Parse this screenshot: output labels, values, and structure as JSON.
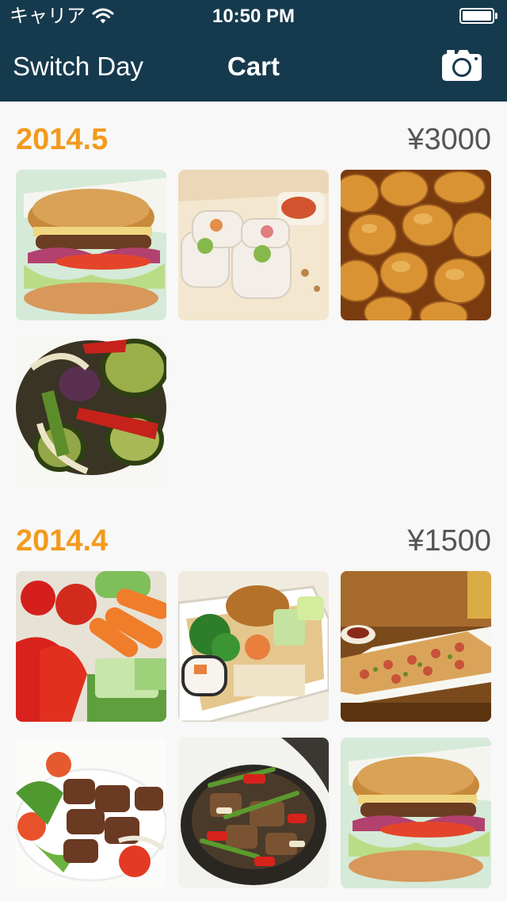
{
  "status_bar": {
    "carrier": "キャリア",
    "time": "10:50 PM"
  },
  "nav": {
    "left_label": "Switch Day",
    "title": "Cart",
    "right_icon": "camera-icon"
  },
  "colors": {
    "nav_background": "#163a4d",
    "date_accent": "#f39a1c",
    "price_text": "#555555",
    "page_background": "#f8f8f8"
  },
  "sections": [
    {
      "date": "2014.5",
      "total": "¥3000",
      "photos": [
        "burger-photo",
        "spring-rolls-photo",
        "bread-rolls-photo",
        "grilled-vegetables-photo"
      ]
    },
    {
      "date": "2014.4",
      "total": "¥1500",
      "photos": [
        "raw-vegetables-photo",
        "bento-photo",
        "flatbread-pizza-photo",
        "beef-salad-photo",
        "stir-fry-pan-photo",
        "burger-photo"
      ]
    }
  ]
}
